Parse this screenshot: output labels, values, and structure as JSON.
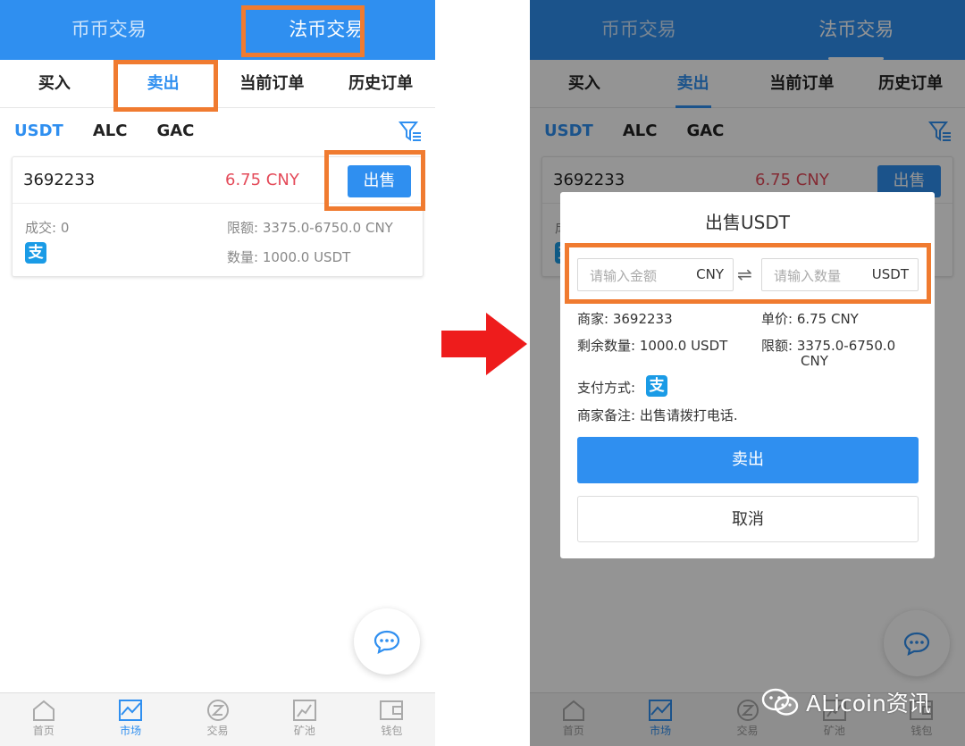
{
  "left": {
    "top_tabs": [
      {
        "label": "币币交易"
      },
      {
        "label": "法币交易"
      }
    ],
    "sub_tabs": [
      {
        "label": "买入"
      },
      {
        "label": "卖出"
      },
      {
        "label": "当前订单"
      },
      {
        "label": "历史订单"
      }
    ],
    "coins": [
      {
        "label": "USDT"
      },
      {
        "label": "ALC"
      },
      {
        "label": "GAC"
      }
    ],
    "card": {
      "merchant_id": "3692233",
      "price": "6.75 CNY",
      "sell_label": "出售",
      "deals": "成交: 0",
      "limit": "限额: 3375.0-6750.0 CNY",
      "quantity": "数量: 1000.0 USDT",
      "alipay_glyph": "支"
    },
    "nav": [
      {
        "label": "首页"
      },
      {
        "label": "市场"
      },
      {
        "label": "交易"
      },
      {
        "label": "矿池"
      },
      {
        "label": "钱包"
      }
    ]
  },
  "right": {
    "top_tabs": [
      {
        "label": "币币交易"
      },
      {
        "label": "法币交易"
      }
    ],
    "sub_tabs": [
      {
        "label": "买入"
      },
      {
        "label": "卖出"
      },
      {
        "label": "当前订单"
      },
      {
        "label": "历史订单"
      }
    ],
    "coins": [
      {
        "label": "USDT"
      },
      {
        "label": "ALC"
      },
      {
        "label": "GAC"
      }
    ],
    "card": {
      "merchant_id": "3692233",
      "price": "6.75 CNY",
      "sell_label": "出售",
      "deals_partial": "成",
      "alipay_glyph": "支"
    },
    "modal": {
      "title": "出售USDT",
      "amount_placeholder": "请输入金额",
      "amount_unit": "CNY",
      "swap_glyph": "⇌",
      "qty_placeholder": "请输入数量",
      "qty_unit": "USDT",
      "merchant": "商家: 3692233",
      "unit_price": "单价: 6.75 CNY",
      "remaining": "剩余数量: 1000.0 USDT",
      "limit_line1": "限额: 3375.0-6750.0",
      "limit_line2": "CNY",
      "payment_label": "支付方式:",
      "alipay_glyph": "支",
      "remark": "商家备注: 出售请拨打电话.",
      "sell_button": "卖出",
      "cancel_button": "取消"
    },
    "nav": [
      {
        "label": "首页"
      },
      {
        "label": "市场"
      },
      {
        "label": "交易"
      },
      {
        "label": "矿池"
      },
      {
        "label": "钱包"
      }
    ]
  },
  "watermark": {
    "text": "ALicoin资讯"
  },
  "colors": {
    "primary": "#2f8ff0",
    "price_red": "#e44b5a",
    "highlight": "#f07b30",
    "arrow_red": "#ee1c1c"
  }
}
